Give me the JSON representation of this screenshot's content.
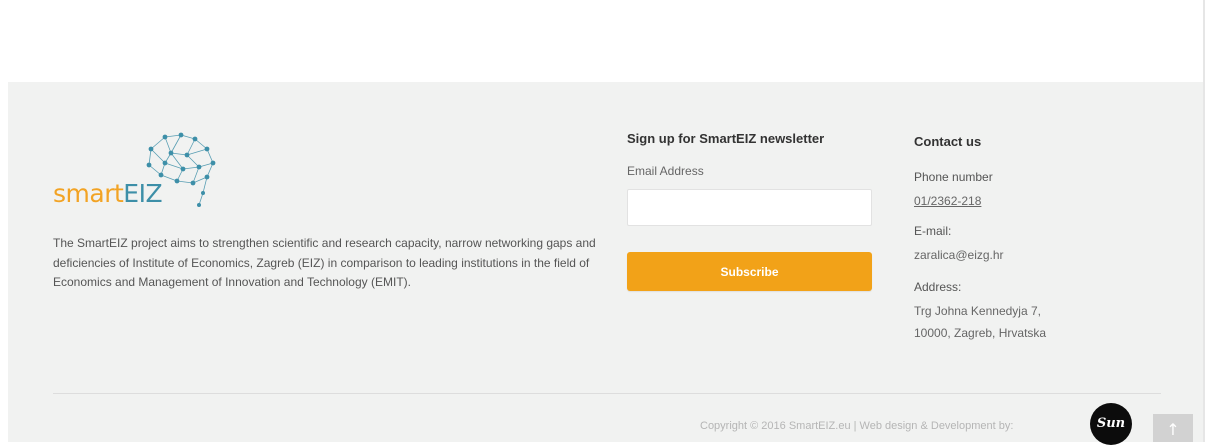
{
  "brand": {
    "logo_smart": "smart",
    "logo_eiz": "EIZ",
    "description": "The SmartEIZ project aims to strengthen scientific and research capacity, narrow networking gaps and deficiencies of Institute of Economics, Zagreb (EIZ) in comparison to leading institutions in the field of Economics and Management of Innovation and Technology (EMIT).",
    "colors": {
      "orange": "#f2a324",
      "teal": "#3d8fa8"
    }
  },
  "newsletter": {
    "title": "Sign up for SmartEIZ newsletter",
    "email_label": "Email Address",
    "email_value": "",
    "email_placeholder": "",
    "subscribe_label": "Subscribe",
    "button_color": "#f2a218"
  },
  "contact": {
    "title": "Contact us",
    "phone_label": "Phone number",
    "phone_value": "01/2362-218",
    "email_label": "E-mail:",
    "email_value": "zaralica@eizg.hr",
    "address_label": "Address:",
    "address_line1": "Trg Johna Kennedyja 7,",
    "address_line2": "10000, Zagreb, Hrvatska"
  },
  "bottom": {
    "copyright": "Copyright © 2016 SmartEIZ.eu | Web design & Development by:",
    "badge_text": "Sun",
    "scroll_top_icon": "arrow-up-icon",
    "scroll_top_glyph": "↑"
  }
}
